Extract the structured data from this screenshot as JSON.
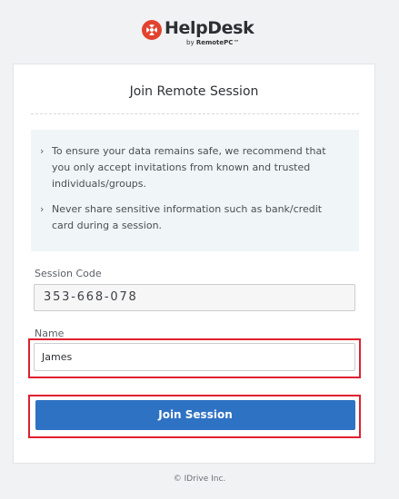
{
  "brand": {
    "name": "HelpDesk",
    "by_prefix": "by ",
    "by_name": "RemotePC",
    "trademark": "™",
    "accent_color": "#e1432e"
  },
  "card": {
    "title": "Join Remote Session",
    "notices": [
      "To ensure your data remains safe, we recommend that you only accept invitations from known and trusted individuals/groups.",
      "Never share sensitive information such as bank/credit card during a session."
    ],
    "notice_bullet": "›"
  },
  "form": {
    "session_code_label": "Session Code",
    "session_code_value": "353-668-078",
    "name_label": "Name",
    "name_value": "James",
    "join_button_label": "Join Session",
    "button_color": "#2e72c4",
    "highlight_color": "#e02030"
  },
  "footer": {
    "copyright": "© IDrive Inc."
  }
}
